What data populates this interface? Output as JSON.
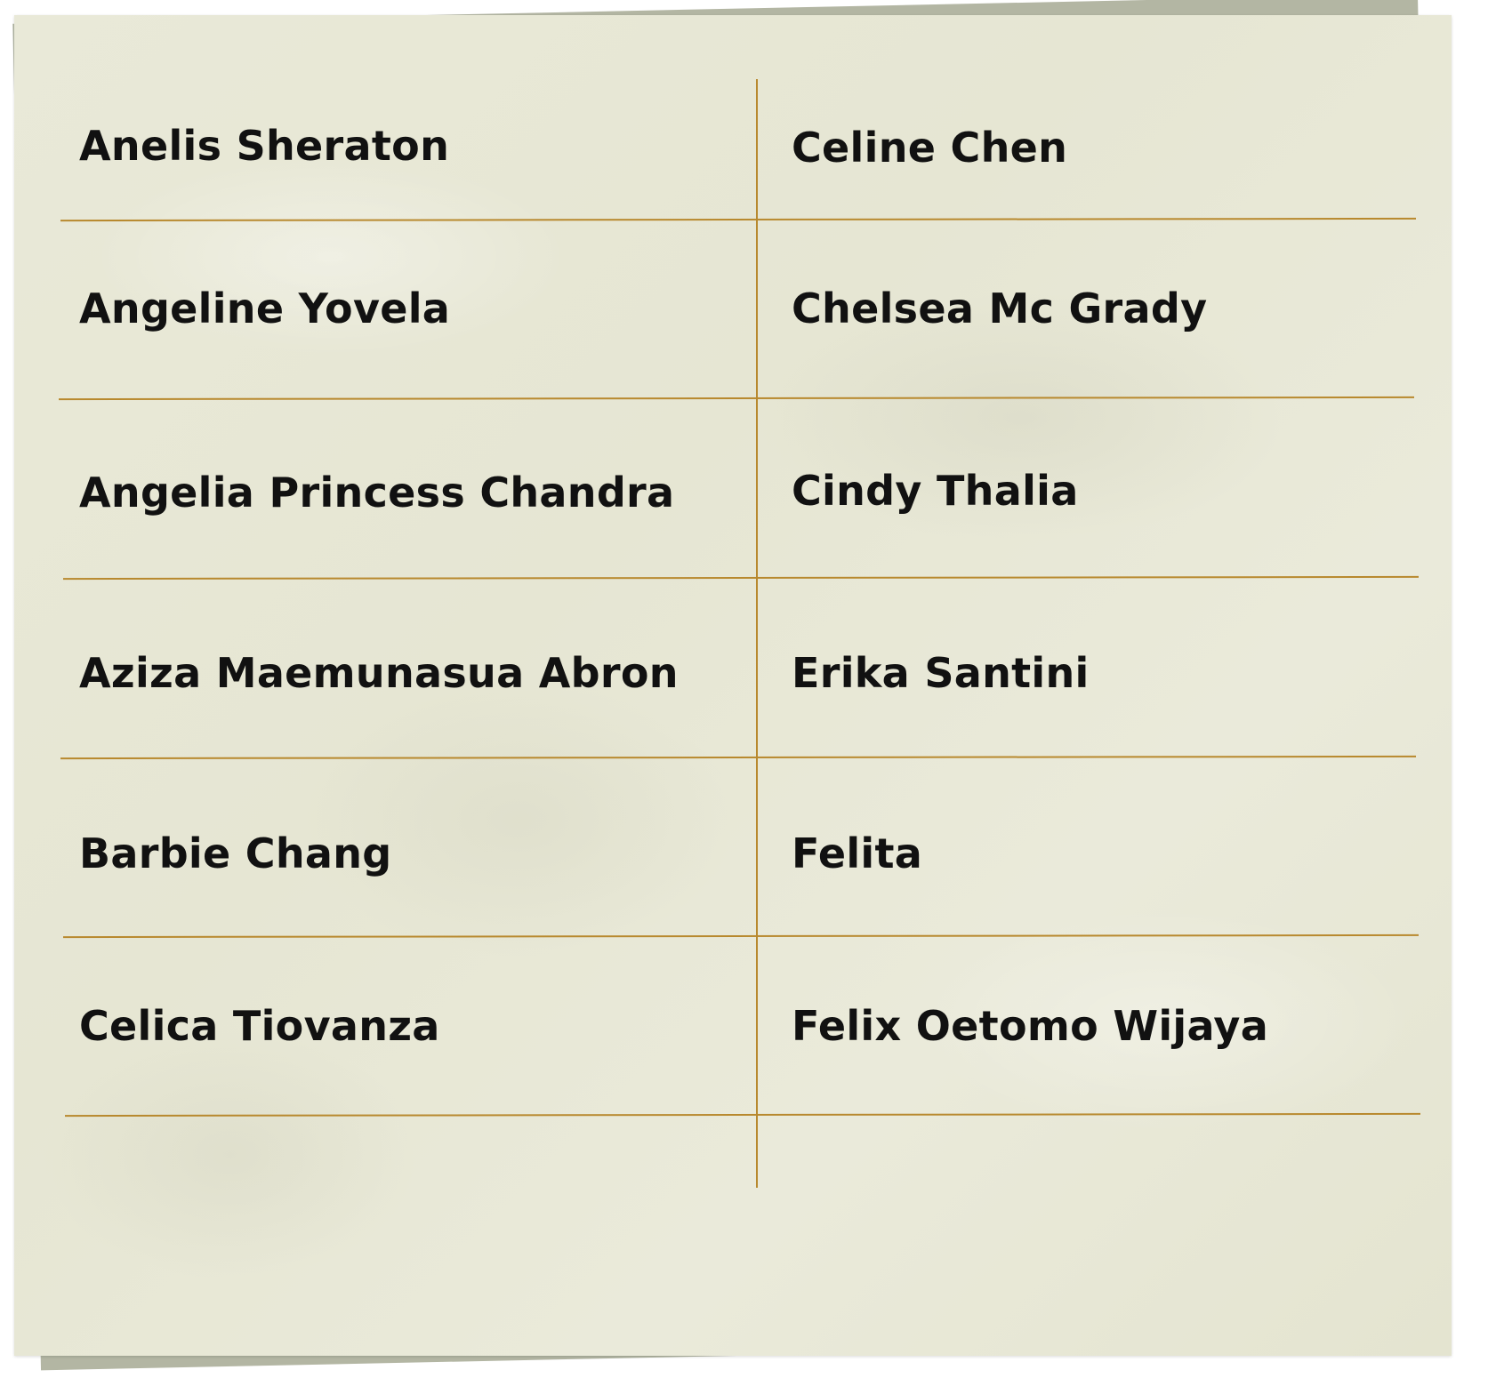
{
  "names_table": {
    "left_column": [
      "Anelis Sheraton",
      "Angeline Yovela",
      "Angelia Princess Chandra",
      "Aziza Maemunasua Abron",
      "Barbie Chang",
      "Celica Tiovanza"
    ],
    "right_column": [
      "Celine Chen",
      "Chelsea Mc Grady",
      "Cindy Thalia",
      "Erika Santini",
      "Felita",
      "Felix Oetomo Wijaya"
    ]
  },
  "colors": {
    "paper": "#e8e8d6",
    "back_sheet": "#b3b6a3",
    "rule_lines": "#b8892e",
    "text": "#111111"
  }
}
